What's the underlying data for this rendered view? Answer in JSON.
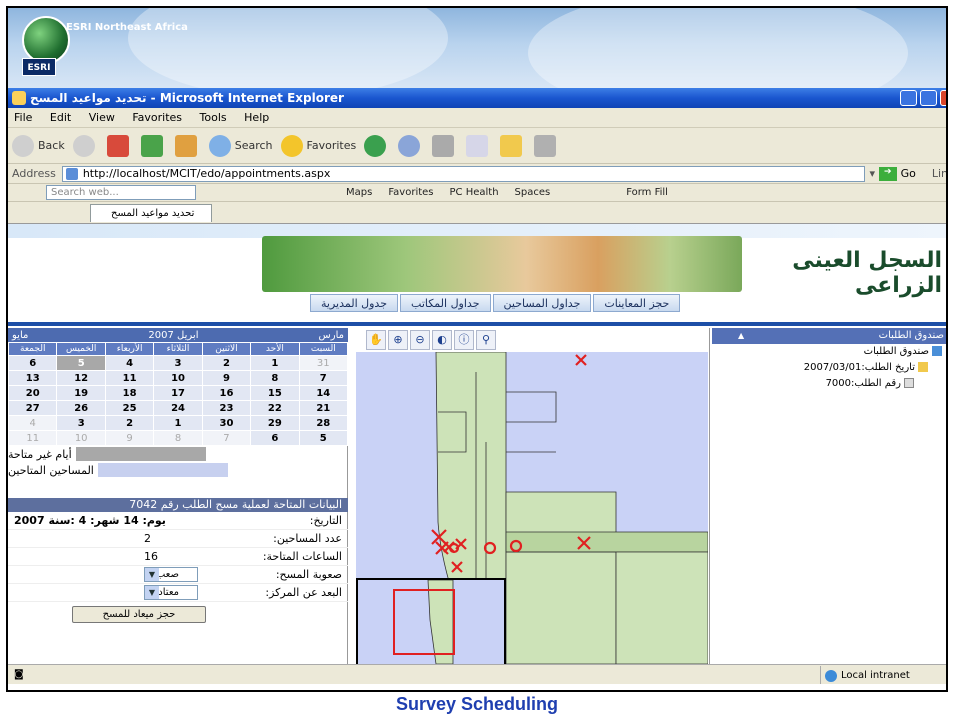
{
  "caption": "Survey Scheduling",
  "banner": {
    "company": "ESRI Northeast Africa",
    "logo_text": "ESRI"
  },
  "window": {
    "title": "تحديد مواعيد المسح - Microsoft Internet Explorer"
  },
  "menu": [
    "File",
    "Edit",
    "View",
    "Favorites",
    "Tools",
    "Help"
  ],
  "toolbar": {
    "back": "Back",
    "search": "Search",
    "favorites": "Favorites"
  },
  "address": {
    "label": "Address",
    "url": "http://localhost/MCIT/edo/appointments.aspx",
    "go": "Go",
    "links": "Lin"
  },
  "searchbar": {
    "placeholder": "Search web...",
    "items": [
      "Maps",
      "Favorites",
      "PC Health",
      "Spaces",
      "Form Fill"
    ]
  },
  "tab": {
    "title": "تحديد مواعيد المسح"
  },
  "site": {
    "title": "السجل العينى الزراعى"
  },
  "nav": [
    "حجز المعاينات",
    "جداول المساحين",
    "جداول المكاتب",
    "جدول المديرية"
  ],
  "calendar": {
    "prev_month": "مارس",
    "current": "ابريل 2007",
    "next_month": "مايو",
    "weekdays": [
      "السبت",
      "الأحد",
      "الاثنين",
      "الثلاثاء",
      "الأربعاء",
      "الخميس",
      "الجمعة"
    ],
    "weeks": [
      [
        {
          "d": "31",
          "s": "off"
        },
        {
          "d": "1"
        },
        {
          "d": "2"
        },
        {
          "d": "3"
        },
        {
          "d": "4"
        },
        {
          "d": "5",
          "s": "gray"
        },
        {
          "d": "6"
        }
      ],
      [
        {
          "d": "7"
        },
        {
          "d": "8"
        },
        {
          "d": "9"
        },
        {
          "d": "10"
        },
        {
          "d": "11"
        },
        {
          "d": "12"
        },
        {
          "d": "13"
        }
      ],
      [
        {
          "d": "14"
        },
        {
          "d": "15"
        },
        {
          "d": "16"
        },
        {
          "d": "17"
        },
        {
          "d": "18"
        },
        {
          "d": "19"
        },
        {
          "d": "20"
        }
      ],
      [
        {
          "d": "21"
        },
        {
          "d": "22"
        },
        {
          "d": "23"
        },
        {
          "d": "24"
        },
        {
          "d": "25"
        },
        {
          "d": "26"
        },
        {
          "d": "27"
        }
      ],
      [
        {
          "d": "28"
        },
        {
          "d": "29"
        },
        {
          "d": "30"
        },
        {
          "d": "1"
        },
        {
          "d": "2"
        },
        {
          "d": "3"
        },
        {
          "d": "4",
          "s": "off"
        }
      ],
      [
        {
          "d": "5"
        },
        {
          "d": "6"
        },
        {
          "d": "7",
          "s": "off"
        },
        {
          "d": "8",
          "s": "off"
        },
        {
          "d": "9",
          "s": "off"
        },
        {
          "d": "10",
          "s": "off"
        },
        {
          "d": "11",
          "s": "off"
        }
      ]
    ],
    "legend_unavailable": "أيام غير متاحة",
    "legend_surveyors": "المساحين المتاحين",
    "legend_colors": [
      "#a8a8a8",
      "#c7d0ef"
    ]
  },
  "form": {
    "header": "البيانات المتاحة لعملية مسح الطلب رقم 7042",
    "date_label": "التاريخ:",
    "date_value": "يوم: 14 شهر: 4 :سنة 2007",
    "surveyors_label": "عدد المساحين:",
    "surveyors_value": "2",
    "hours_label": "الساعات المتاحة:",
    "hours_value": "16",
    "difficulty_label": "صعوبة المسح:",
    "difficulty_value": "صعب",
    "distance_label": "البعد عن المركز:",
    "distance_value": "معتاد",
    "book_button": "حجز ميعاد للمسح"
  },
  "map_tools": [
    "pan-icon",
    "zoom-in-icon",
    "zoom-out-icon",
    "full-extent-icon",
    "identify-icon",
    "find-icon"
  ],
  "tree": {
    "header": "صندوق الطلبات",
    "root": "صندوق الطلبات",
    "date_node": "تاريخ الطلب:2007/03/01",
    "request_node": "رقم الطلب:7000"
  },
  "status": {
    "zone": "Local intranet"
  },
  "colors": {
    "map_water": "#c9d2f6",
    "map_parcel": "#cde3b8",
    "marker": "#e02020",
    "accent": "#1d4fa7"
  }
}
